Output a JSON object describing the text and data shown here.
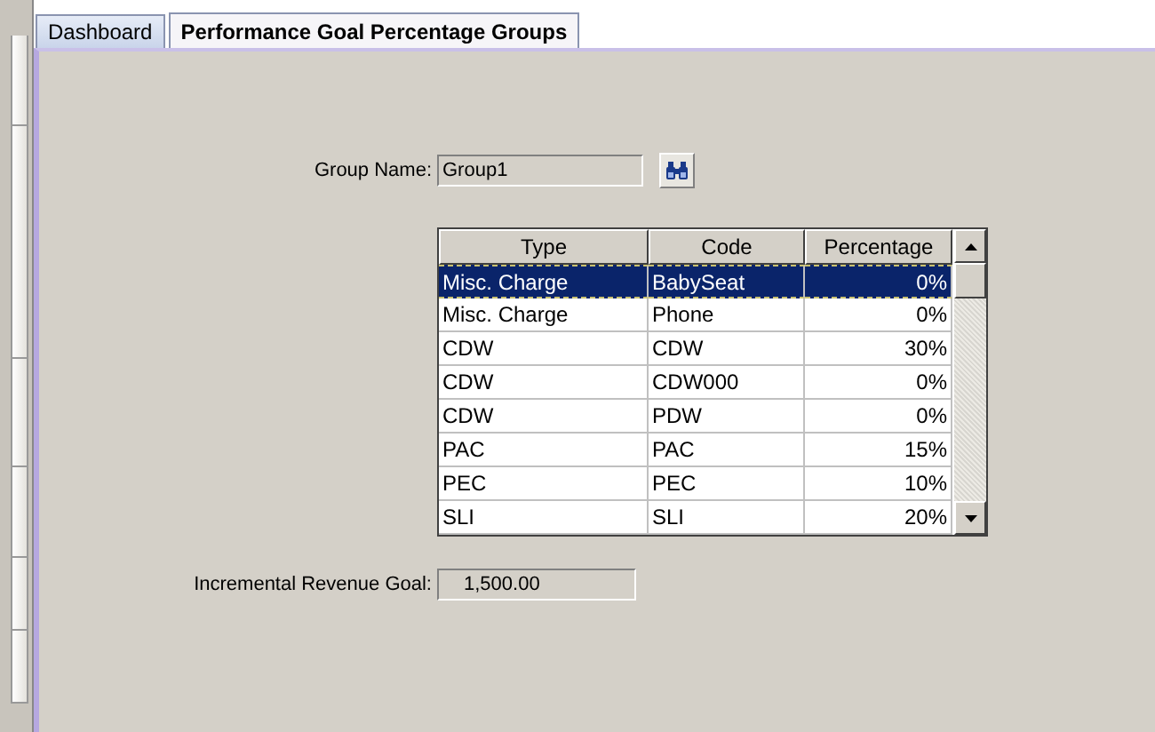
{
  "tabs": [
    {
      "label": "Dashboard",
      "selected": false
    },
    {
      "label": "Performance Goal Percentage Groups",
      "selected": true
    }
  ],
  "group_name": {
    "label": "Group Name:",
    "value": "Group1"
  },
  "table": {
    "columns": [
      "Type",
      "Code",
      "Percentage"
    ],
    "rows": [
      {
        "cells": [
          "Misc. Charge",
          "BabySeat",
          "0%"
        ],
        "selected": true
      },
      {
        "cells": [
          "Misc. Charge",
          "Phone",
          "0%"
        ],
        "selected": false
      },
      {
        "cells": [
          "CDW",
          "CDW",
          "30%"
        ],
        "selected": false
      },
      {
        "cells": [
          "CDW",
          "CDW000",
          "0%"
        ],
        "selected": false
      },
      {
        "cells": [
          "CDW",
          "PDW",
          "0%"
        ],
        "selected": false
      },
      {
        "cells": [
          "PAC",
          "PAC",
          "15%"
        ],
        "selected": false
      },
      {
        "cells": [
          "PEC",
          "PEC",
          "10%"
        ],
        "selected": false
      },
      {
        "cells": [
          "SLI",
          "SLI",
          "20%"
        ],
        "selected": false
      }
    ]
  },
  "incremental_revenue_goal": {
    "label": "Incremental Revenue Goal:",
    "value": "1,500.00"
  }
}
